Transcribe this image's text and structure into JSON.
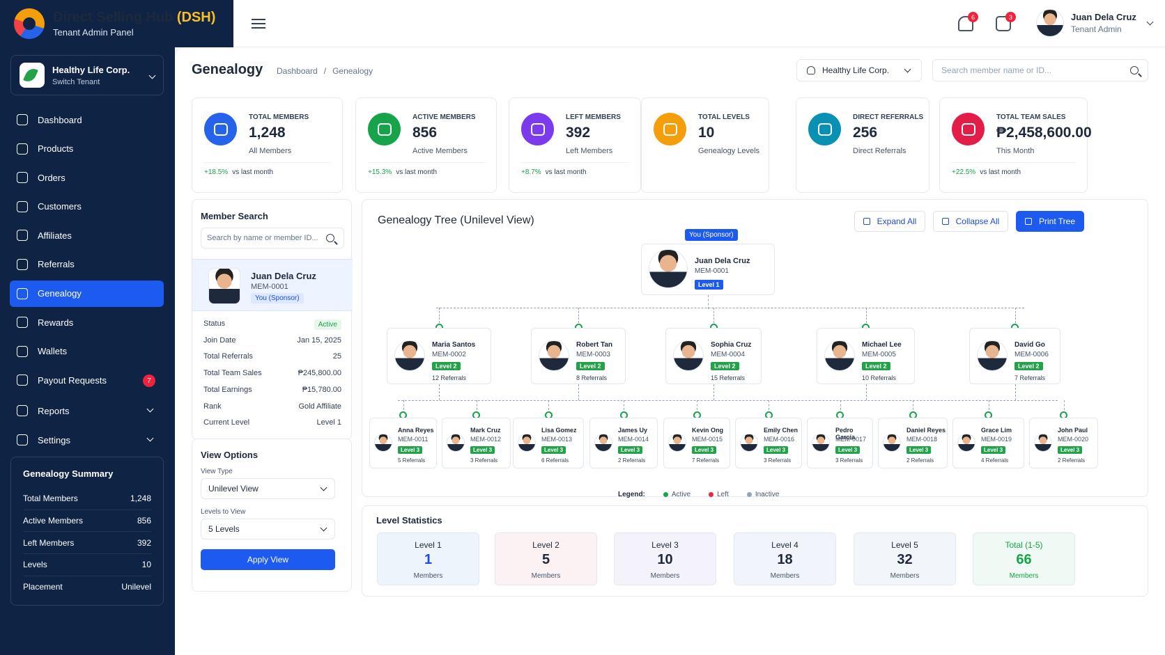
{
  "brand": {
    "title": "Direct Selling Hub",
    "accent": "(DSH)",
    "subtitle": "Tenant Admin Panel"
  },
  "tenant": {
    "name": "Healthy Life Corp.",
    "action": "Switch Tenant"
  },
  "nav": [
    {
      "label": "Dashboard",
      "icon": "home-icon"
    },
    {
      "label": "Products",
      "icon": "box-icon"
    },
    {
      "label": "Orders",
      "icon": "clipboard-icon"
    },
    {
      "label": "Customers",
      "icon": "users-icon"
    },
    {
      "label": "Affiliates",
      "icon": "user-icon"
    },
    {
      "label": "Referrals",
      "icon": "referral-icon"
    },
    {
      "label": "Genealogy",
      "icon": "tree-icon",
      "active": true
    },
    {
      "label": "Rewards",
      "icon": "gift-icon"
    },
    {
      "label": "Wallets",
      "icon": "wallet-icon"
    },
    {
      "label": "Payout Requests",
      "icon": "payout-icon",
      "badge": "7"
    },
    {
      "label": "Reports",
      "icon": "report-icon",
      "chevron": true
    },
    {
      "label": "Settings",
      "icon": "gear-icon",
      "chevron": true
    }
  ],
  "summary": {
    "title": "Genealogy Summary",
    "rows": [
      {
        "label": "Total Members",
        "value": "1,248"
      },
      {
        "label": "Active Members",
        "value": "856"
      },
      {
        "label": "Left Members",
        "value": "392"
      },
      {
        "label": "Levels",
        "value": "10"
      },
      {
        "label": "Placement",
        "value": "Unilevel"
      }
    ]
  },
  "topbar": {
    "notifications": "6",
    "messages": "3",
    "user_name": "Juan Dela Cruz",
    "user_role": "Tenant Admin"
  },
  "page": {
    "title": "Genealogy",
    "crumb1": "Dashboard",
    "crumb_sep": "/",
    "crumb2": "Genealogy",
    "tenant_select": "Healthy Life Corp.",
    "search_placeholder": "Search member name or ID..."
  },
  "stats": [
    {
      "label": "TOTAL MEMBERS",
      "value": "1,248",
      "sub": "All Members",
      "trend": "+18.5%",
      "trend_text": "vs last month",
      "color": "#2563eb"
    },
    {
      "label": "ACTIVE MEMBERS",
      "value": "856",
      "sub": "Active Members",
      "trend": "+15.3%",
      "trend_text": "vs last month",
      "color": "#16a34a"
    },
    {
      "label": "LEFT MEMBERS",
      "value": "392",
      "sub": "Left Members",
      "trend": "+8.7%",
      "trend_text": "vs last month",
      "color": "#7c3aed"
    },
    {
      "label": "TOTAL LEVELS",
      "value": "10",
      "sub": "Genealogy Levels",
      "trend": "",
      "trend_text": "",
      "color": "#f59e0b"
    },
    {
      "label": "DIRECT REFERRALS",
      "value": "256",
      "sub": "Direct Referrals",
      "trend": "",
      "trend_text": "",
      "color": "#0891b2"
    },
    {
      "label": "TOTAL TEAM SALES",
      "value": "₱2,458,600.00",
      "sub": "This Month",
      "trend": "+22.5%",
      "trend_text": "vs last month",
      "color": "#e11d48"
    }
  ],
  "member_search": {
    "title": "Member Search",
    "placeholder": "Search by name or member ID...",
    "name": "Juan Dela Cruz",
    "id": "MEM-0001",
    "tag": "You (Sponsor)",
    "details": [
      {
        "label": "Status",
        "value": "Active"
      },
      {
        "label": "Join Date",
        "value": "Jan 15, 2025"
      },
      {
        "label": "Total Referrals",
        "value": "25"
      },
      {
        "label": "Total Team Sales",
        "value": "₱245,800.00"
      },
      {
        "label": "Total Earnings",
        "value": "₱15,780.00"
      },
      {
        "label": "Rank",
        "value": "Gold Affiliate"
      },
      {
        "label": "Current Level",
        "value": "Level 1"
      }
    ]
  },
  "view_options": {
    "title": "View Options",
    "type_label": "View Type",
    "type_value": "Unilevel View",
    "levels_label": "Levels to View",
    "levels_value": "5 Levels",
    "apply": "Apply View"
  },
  "tree": {
    "title": "Genealogy Tree (Unilevel View)",
    "expand": "Expand All",
    "collapse": "Collapse All",
    "print": "Print Tree",
    "root": {
      "tag": "You (Sponsor)",
      "name": "Juan Dela Cruz",
      "id": "MEM-0001",
      "level": "Level 1"
    },
    "level2": [
      {
        "name": "Maria Santos",
        "id": "MEM-0002",
        "level": "Level 2",
        "refs": "12 Referrals"
      },
      {
        "name": "Robert Tan",
        "id": "MEM-0003",
        "level": "Level 2",
        "refs": "8 Referrals"
      },
      {
        "name": "Sophia Cruz",
        "id": "MEM-0004",
        "level": "Level 2",
        "refs": "15 Referrals"
      },
      {
        "name": "Michael Lee",
        "id": "MEM-0005",
        "level": "Level 2",
        "refs": "10 Referrals"
      },
      {
        "name": "David Go",
        "id": "MEM-0006",
        "level": "Level 2",
        "refs": "7 Referrals"
      }
    ],
    "level3": [
      {
        "name": "Anna Reyes",
        "id": "MEM-0011",
        "level": "Level 3",
        "refs": "5 Referrals"
      },
      {
        "name": "Mark Cruz",
        "id": "MEM-0012",
        "level": "Level 3",
        "refs": "3 Referrals"
      },
      {
        "name": "Lisa Gomez",
        "id": "MEM-0013",
        "level": "Level 3",
        "refs": "6 Referrals"
      },
      {
        "name": "James Uy",
        "id": "MEM-0014",
        "level": "Level 3",
        "refs": "2 Referrals"
      },
      {
        "name": "Kevin Ong",
        "id": "MEM-0015",
        "level": "Level 3",
        "refs": "7 Referrals"
      },
      {
        "name": "Emily Chen",
        "id": "MEM-0016",
        "level": "Level 3",
        "refs": "3 Referrals"
      },
      {
        "name": "Pedro Garcia",
        "id": "MEM-0017",
        "level": "Level 3",
        "refs": "3 Referrals"
      },
      {
        "name": "Daniel Reyes",
        "id": "MEM-0018",
        "level": "Level 3",
        "refs": "2 Referrals"
      },
      {
        "name": "Grace Lim",
        "id": "MEM-0019",
        "level": "Level 3",
        "refs": "4 Referrals"
      },
      {
        "name": "John Paul",
        "id": "MEM-0020",
        "level": "Level 3",
        "refs": "2 Referrals"
      }
    ],
    "legend": {
      "title": "Legend:",
      "active": "Active",
      "left": "Left",
      "inactive": "Inactive",
      "active_color": "#16a34a",
      "left_color": "#ef233c",
      "inactive_color": "#94a3b8"
    }
  },
  "level_stats": {
    "title": "Level Statistics",
    "items": [
      {
        "title": "Level 1",
        "value": "1",
        "unit": "Members",
        "bg": "#eef4fc",
        "color": "#1d4ed8"
      },
      {
        "title": "Level 2",
        "value": "5",
        "unit": "Members",
        "bg": "#fcf1f3",
        "color": "#1e293b"
      },
      {
        "title": "Level 3",
        "value": "10",
        "unit": "Members",
        "bg": "#f4f3fb",
        "color": "#1e293b"
      },
      {
        "title": "Level 4",
        "value": "18",
        "unit": "Members",
        "bg": "#f1f4fb",
        "color": "#1e293b"
      },
      {
        "title": "Level 5",
        "value": "32",
        "unit": "Members",
        "bg": "#f2f5fa",
        "color": "#1e293b"
      },
      {
        "title": "Total (1-5)",
        "value": "66",
        "unit": "Members",
        "bg": "#f0f9f3",
        "color": "#16a34a"
      }
    ]
  }
}
